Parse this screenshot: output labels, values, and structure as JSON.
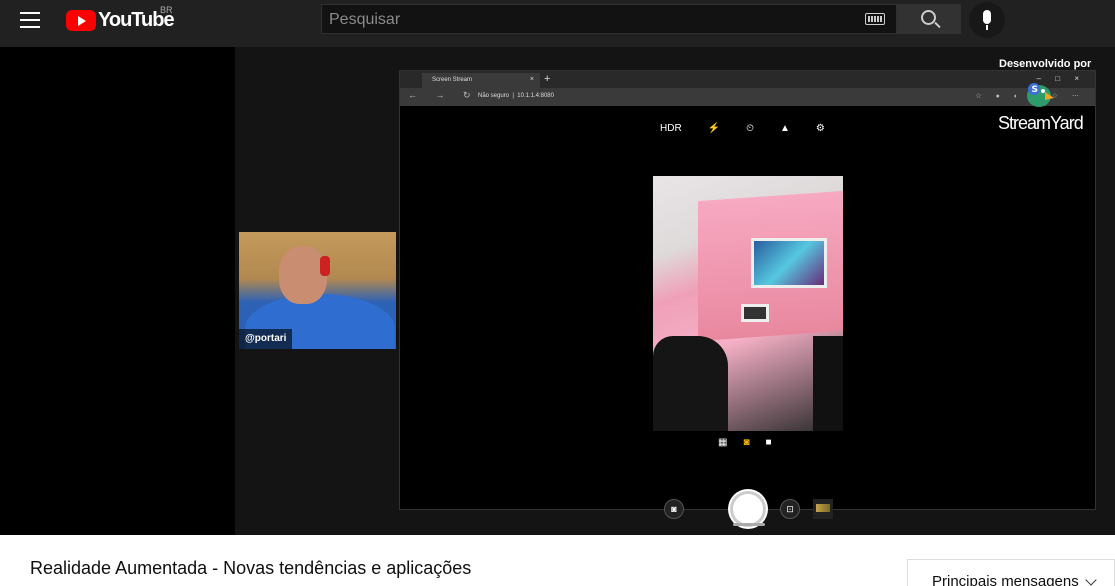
{
  "masthead": {
    "logo_text": "YouTube",
    "country_code": "BR",
    "search_placeholder": "Pesquisar",
    "icons": [
      "menu-icon",
      "keyboard-icon",
      "search-icon",
      "mic-icon"
    ]
  },
  "video_frame": {
    "browser": {
      "tab_title": "Screen Stream",
      "tab_close": "×",
      "new_tab": "+",
      "window_controls": "– □ ×",
      "nav": "← → ↻",
      "security_label": "Não seguro",
      "url": "10.1.1.4:8080",
      "extensions": "☆ ● ◐ ◻ ☆ ⋯"
    },
    "camera_app": {
      "top_icons": [
        "HDR",
        "⚡",
        "⏲",
        "▲",
        "⚙"
      ],
      "mode_icons": [
        "▦",
        "◙",
        "■"
      ],
      "left_button": "◙",
      "right_button": "⊡"
    },
    "webcam": {
      "name_tag": "@portari"
    },
    "branding": {
      "title": "Desenvolvido por",
      "name": "StreamYard"
    },
    "colors": {
      "accent_red": "#ff0000",
      "camera_active": "#f6b500"
    }
  },
  "video": {
    "title": "Realidade Aumentada - Novas tendências e aplicações"
  },
  "chat": {
    "filter_label": "Principais mensagens"
  }
}
